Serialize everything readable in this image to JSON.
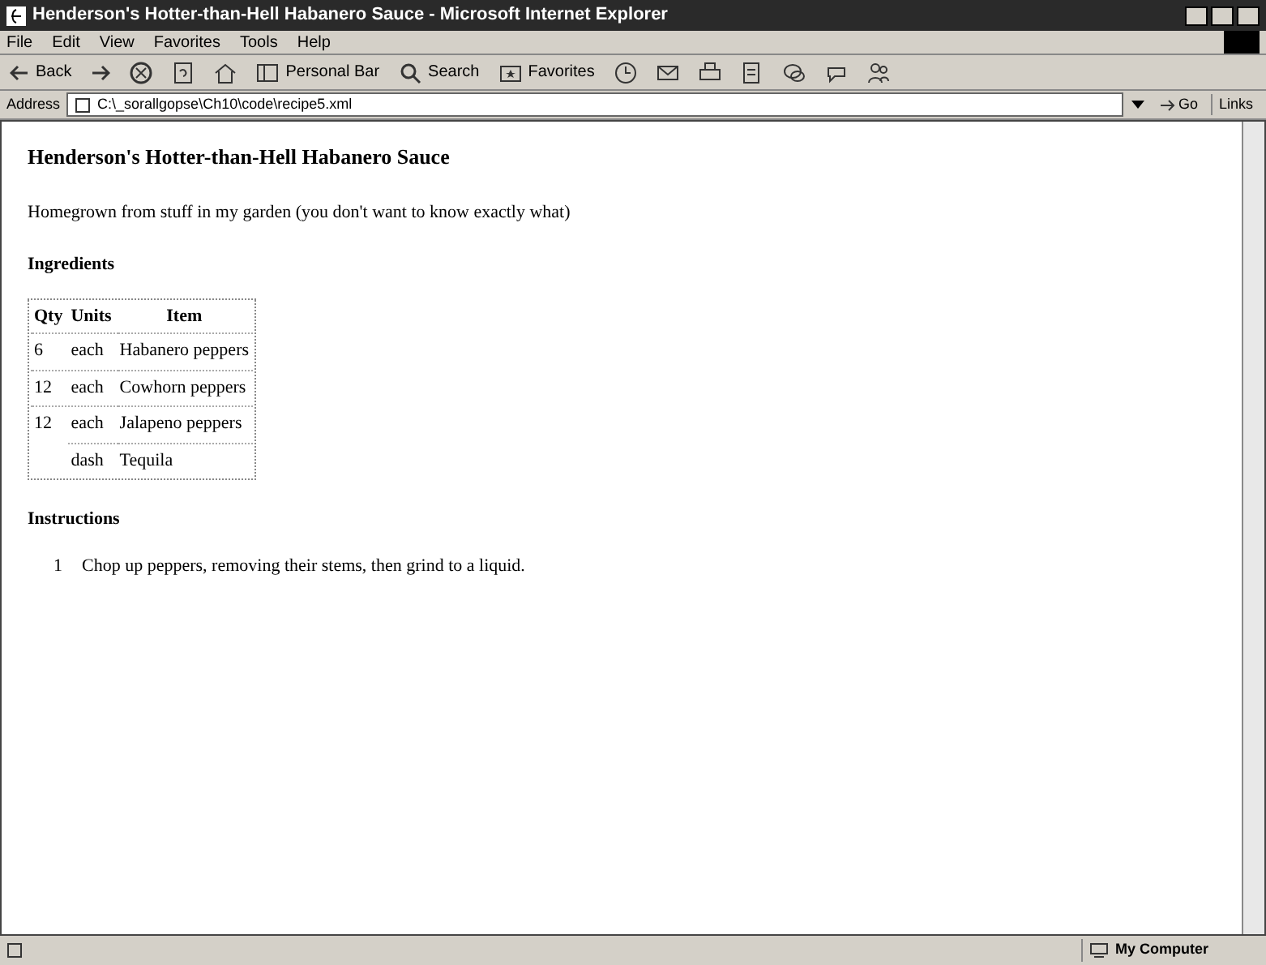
{
  "window": {
    "title": "Henderson's Hotter-than-Hell Habanero Sauce - Microsoft Internet Explorer"
  },
  "menu": [
    "File",
    "Edit",
    "View",
    "Favorites",
    "Tools",
    "Help"
  ],
  "toolbar": [
    {
      "kind": "back",
      "label": "Back"
    },
    {
      "kind": "forward"
    },
    {
      "kind": "stop"
    },
    {
      "kind": "refresh"
    },
    {
      "kind": "home"
    },
    {
      "kind": "personal",
      "label": "Personal Bar"
    },
    {
      "kind": "search",
      "label": "Search"
    },
    {
      "kind": "favorites",
      "label": "Favorites"
    },
    {
      "kind": "history"
    },
    {
      "kind": "mail"
    },
    {
      "kind": "print"
    },
    {
      "kind": "edit"
    },
    {
      "kind": "discuss"
    },
    {
      "kind": "messenger"
    },
    {
      "kind": "people"
    }
  ],
  "address": {
    "label": "Address",
    "value": "C:\\_sorallgopse\\Ch10\\code\\recipe5.xml",
    "go": "Go",
    "links": "Links"
  },
  "page": {
    "heading": "Henderson's Hotter-than-Hell Habanero Sauce",
    "intro": "Homegrown from stuff in my garden (you don't want to know exactly what)",
    "ingredients_heading": "Ingredients",
    "table": {
      "columns": [
        "Qty",
        "Units",
        "Item"
      ],
      "rows": [
        [
          "6",
          "each",
          "Habanero peppers"
        ],
        [
          "12",
          "each",
          "Cowhorn peppers"
        ],
        [
          "12",
          "each",
          "Jalapeno peppers"
        ],
        [
          null,
          "dash",
          "Tequila"
        ]
      ]
    },
    "instructions_heading": "Instructions",
    "instructions": [
      {
        "number": "1",
        "text": "Chop up peppers, removing their stems, then grind to a liquid."
      }
    ]
  },
  "status_bar": {
    "zone": "My Computer"
  }
}
